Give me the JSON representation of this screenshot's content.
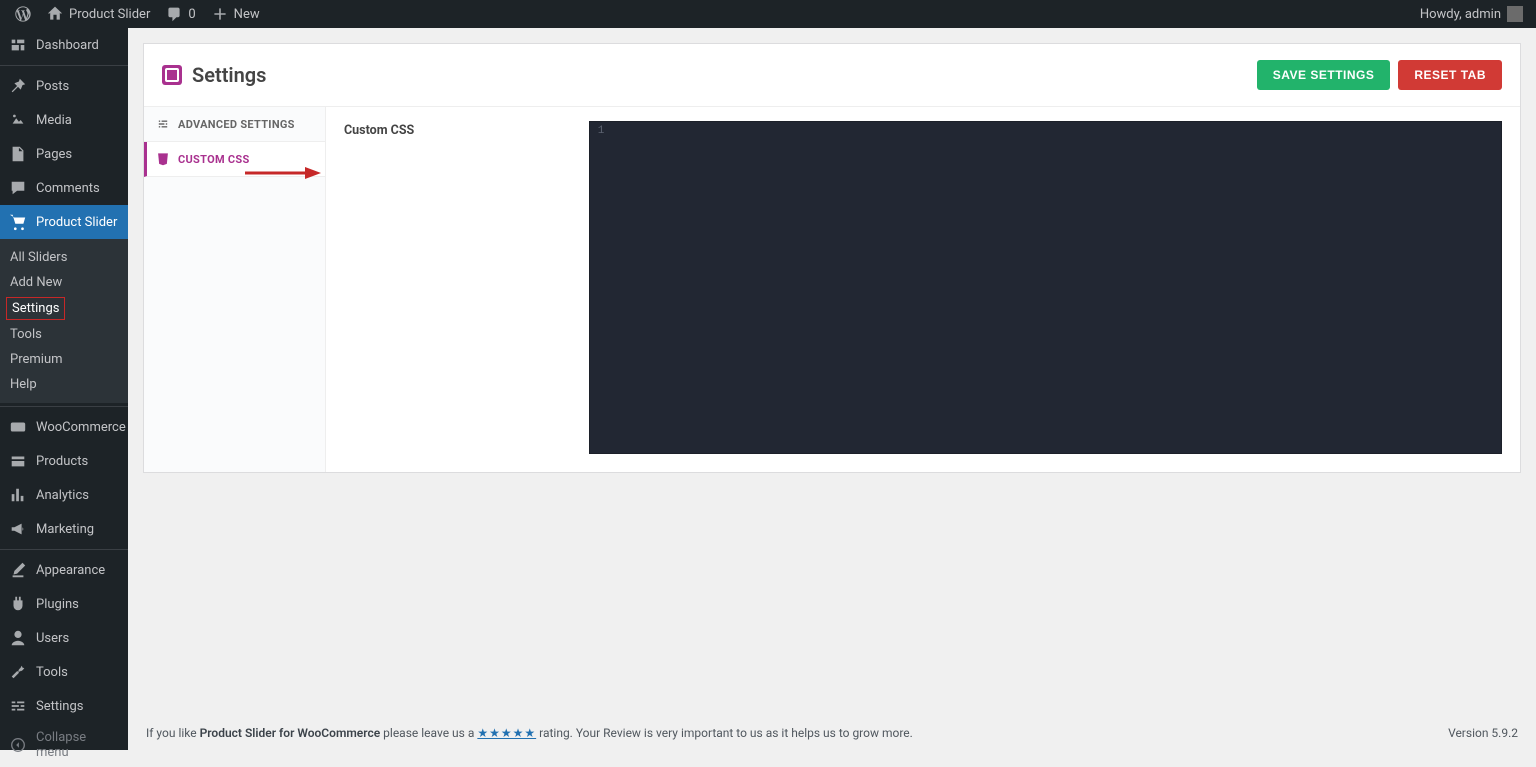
{
  "topbar": {
    "site_name": "Product Slider",
    "comments_count": "0",
    "new_label": "New",
    "howdy": "Howdy, admin"
  },
  "sidebar": {
    "items": [
      {
        "label": "Dashboard",
        "icon": "dashboard"
      },
      {
        "label": "Posts",
        "icon": "pin"
      },
      {
        "label": "Media",
        "icon": "media"
      },
      {
        "label": "Pages",
        "icon": "page"
      },
      {
        "label": "Comments",
        "icon": "comment"
      },
      {
        "label": "Product Slider",
        "icon": "cart",
        "active": true
      },
      {
        "label": "WooCommerce",
        "icon": "woo"
      },
      {
        "label": "Products",
        "icon": "products"
      },
      {
        "label": "Analytics",
        "icon": "analytics"
      },
      {
        "label": "Marketing",
        "icon": "megaphone"
      },
      {
        "label": "Appearance",
        "icon": "brush"
      },
      {
        "label": "Plugins",
        "icon": "plugin"
      },
      {
        "label": "Users",
        "icon": "user"
      },
      {
        "label": "Tools",
        "icon": "wrench"
      },
      {
        "label": "Settings",
        "icon": "settings"
      },
      {
        "label": "Collapse menu",
        "icon": "collapse"
      }
    ],
    "sub": [
      "All Sliders",
      "Add New",
      "Settings",
      "Tools",
      "Premium",
      "Help"
    ]
  },
  "page": {
    "title": "Settings",
    "save_btn": "SAVE SETTINGS",
    "reset_btn": "RESET TAB",
    "tabs": {
      "advanced": "ADVANCED SETTINGS",
      "css": "CUSTOM CSS"
    },
    "field_label": "Custom CSS",
    "editor_line": "1"
  },
  "footer": {
    "prefix": "If you like ",
    "product": "Product Slider for WooCommerce",
    "mid": " please leave us a ",
    "stars": "★★★★★",
    "suffix": " rating. Your Review is very important to us as it helps us to grow more.",
    "version": "Version 5.9.2"
  }
}
